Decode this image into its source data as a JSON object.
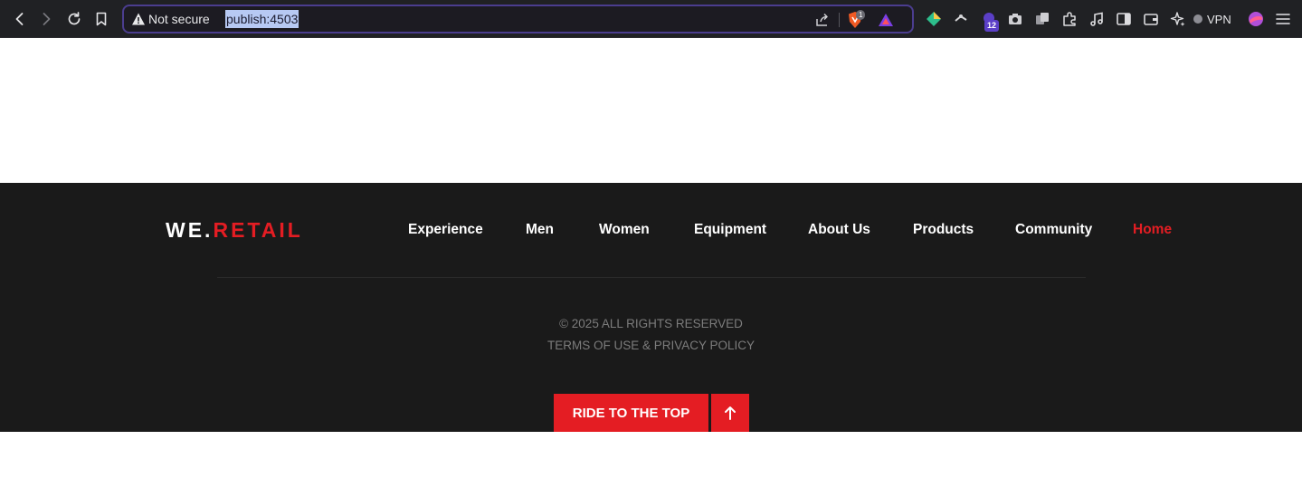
{
  "browser": {
    "security_label": "Not secure",
    "url": "publish:4503",
    "brave_shield_count": "1",
    "extensions_badge": "12",
    "vpn_label": "VPN",
    "accent_color": "#4b3d8f",
    "icons": [
      "back-icon",
      "forward-icon",
      "reload-icon",
      "bookmark-icon",
      "warning-icon",
      "share-icon",
      "brave-shield-icon",
      "brave-rewards-icon",
      "extension-diamond-icon",
      "extension-tool-icon",
      "extension-badge-icon",
      "camera-icon",
      "copy-icon",
      "puzzle-icon",
      "music-icon",
      "sidebar-icon",
      "wallet-icon",
      "leo-ai-icon",
      "vpn-icon",
      "profile-icon",
      "menu-icon"
    ]
  },
  "footer": {
    "logo": {
      "part1": "WE.",
      "part2": "RETAIL"
    },
    "nav": [
      {
        "label": "Experience"
      },
      {
        "label": "Men"
      },
      {
        "label": "Women"
      },
      {
        "label": "Equipment"
      },
      {
        "label": "About Us"
      },
      {
        "label": "Products"
      },
      {
        "label": "Community"
      },
      {
        "label": "Home",
        "active": true
      }
    ],
    "copyright": "© 2025 ALL RIGHTS RESERVED",
    "legal_links": "TERMS OF USE & PRIVACY POLICY",
    "back_to_top_label": "RIDE TO THE TOP",
    "colors": {
      "background": "#1a1a1a",
      "accent": "#e41d23",
      "muted_text": "#7c7c7c"
    }
  }
}
